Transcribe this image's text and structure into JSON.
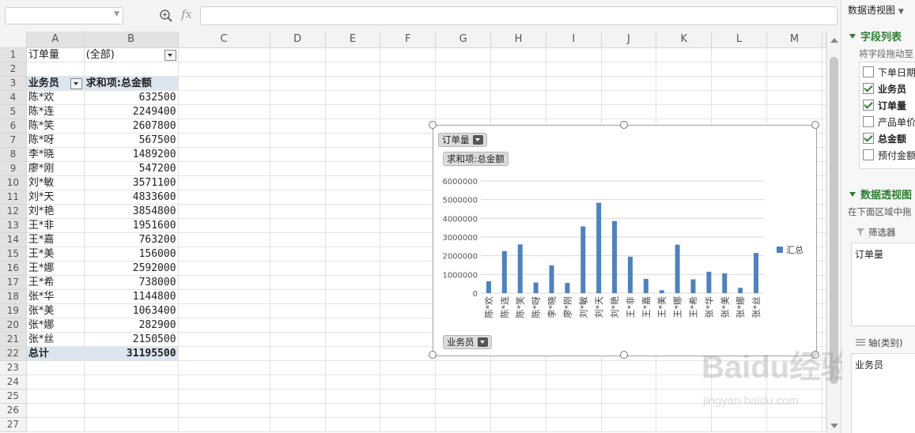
{
  "formula_bar": {
    "fx": "fx"
  },
  "columns": [
    "A",
    "B",
    "C",
    "D",
    "E",
    "F",
    "G",
    "H",
    "I",
    "J",
    "K",
    "L",
    "M"
  ],
  "rows": [
    {
      "n": "1",
      "a": "订单量",
      "b": "(全部)",
      "a_kind": "filter"
    },
    {
      "n": "2",
      "a": "",
      "b": ""
    },
    {
      "n": "3",
      "a": "业务员",
      "b": "求和项:总金额",
      "a_kind": "header"
    },
    {
      "n": "4",
      "a": "陈*欢",
      "b": "632500"
    },
    {
      "n": "5",
      "a": "陈*连",
      "b": "2249400"
    },
    {
      "n": "6",
      "a": "陈*笑",
      "b": "2607800"
    },
    {
      "n": "7",
      "a": "陈*呀",
      "b": "567500"
    },
    {
      "n": "8",
      "a": "李*晓",
      "b": "1489200"
    },
    {
      "n": "9",
      "a": "廖*刚",
      "b": "547200"
    },
    {
      "n": "10",
      "a": "刘*敏",
      "b": "3571100"
    },
    {
      "n": "11",
      "a": "刘*天",
      "b": "4833600"
    },
    {
      "n": "12",
      "a": "刘*艳",
      "b": "3854800"
    },
    {
      "n": "13",
      "a": "王*非",
      "b": "1951600"
    },
    {
      "n": "14",
      "a": "王*嘉",
      "b": "763200"
    },
    {
      "n": "15",
      "a": "王*美",
      "b": "156000"
    },
    {
      "n": "16",
      "a": "王*娜",
      "b": "2592000"
    },
    {
      "n": "17",
      "a": "王*希",
      "b": "738000"
    },
    {
      "n": "18",
      "a": "张*华",
      "b": "1144800"
    },
    {
      "n": "19",
      "a": "张*美",
      "b": "1063400"
    },
    {
      "n": "20",
      "a": "张*娜",
      "b": "282900"
    },
    {
      "n": "21",
      "a": "张*丝",
      "b": "2150500"
    },
    {
      "n": "22",
      "a": "总计",
      "b": "31195500",
      "a_kind": "total"
    },
    {
      "n": "23",
      "a": "",
      "b": ""
    },
    {
      "n": "24",
      "a": "",
      "b": ""
    },
    {
      "n": "25",
      "a": "",
      "b": ""
    },
    {
      "n": "26",
      "a": "",
      "b": ""
    },
    {
      "n": "27",
      "a": "",
      "b": ""
    }
  ],
  "chart": {
    "filter_button": "订单量",
    "value_button": "求和项:总金额",
    "axis_button": "业务员",
    "legend": "汇总",
    "bar_color": "#4f81bd"
  },
  "chart_data": {
    "type": "bar",
    "categories": [
      "陈*欢",
      "陈*连",
      "陈*笑",
      "陈*呀",
      "李*晓",
      "廖*刚",
      "刘*敏",
      "刘*天",
      "刘*艳",
      "王*非",
      "王*嘉",
      "王*美",
      "王*娜",
      "王*希",
      "张*华",
      "张*美",
      "张*娜",
      "张*丝"
    ],
    "series": [
      {
        "name": "汇总",
        "values": [
          632500,
          2249400,
          2607800,
          567500,
          1489200,
          547200,
          3571100,
          4833600,
          3854800,
          1951600,
          763200,
          156000,
          2592000,
          738000,
          1144800,
          1063400,
          282900,
          2150500
        ]
      }
    ],
    "yticks": [
      "0",
      "1000000",
      "2000000",
      "3000000",
      "4000000",
      "5000000",
      "6000000"
    ],
    "ylim": [
      0,
      6000000
    ],
    "grid": true,
    "legend_position": "right"
  },
  "panel": {
    "title": "数据透视图",
    "field_list_title": "字段列表",
    "drag_hint": "将字段拖动至",
    "fields": [
      {
        "label": "下单日期",
        "checked": false
      },
      {
        "label": "业务员",
        "checked": true
      },
      {
        "label": "订单量",
        "checked": true
      },
      {
        "label": "产品单价",
        "checked": false
      },
      {
        "label": "总金额",
        "checked": true
      },
      {
        "label": "预付金额",
        "checked": false
      }
    ],
    "areas_title": "数据透视图",
    "areas_hint": "在下面区域中拖",
    "filter_label": "筛选器",
    "filter_value": "订单量",
    "axis_label": "轴(类别)",
    "axis_value": "业务员"
  },
  "watermark": {
    "brand": "Baidu经验",
    "url": "jingyan.baidu.com"
  }
}
